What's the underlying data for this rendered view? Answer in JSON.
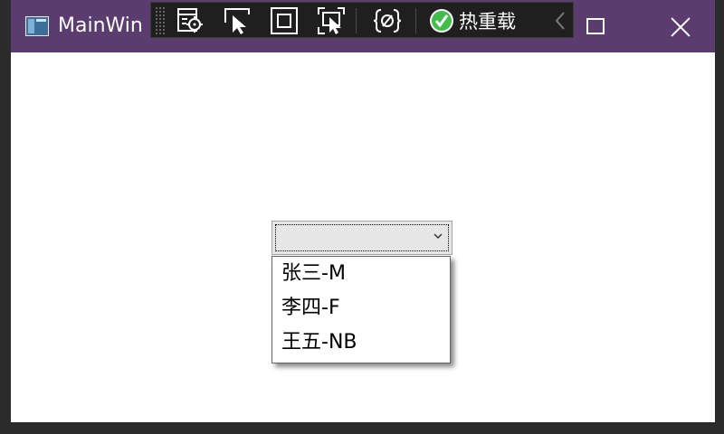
{
  "window": {
    "title": "MainWin",
    "accent": "#5a3c6e"
  },
  "toolbar": {
    "buttons": [
      {
        "icon": "select-element-icon"
      },
      {
        "icon": "pointer-select-icon"
      },
      {
        "icon": "display-layout-adorners-icon"
      },
      {
        "icon": "track-focused-element-icon"
      },
      {
        "icon": "binding-failures-icon"
      }
    ],
    "hot_reload_label": "热重载",
    "hot_reload_status_color": "#3fbf4a"
  },
  "combobox": {
    "selected": "",
    "options": [
      "张三-M",
      "李四-F",
      "王五-NB"
    ]
  }
}
